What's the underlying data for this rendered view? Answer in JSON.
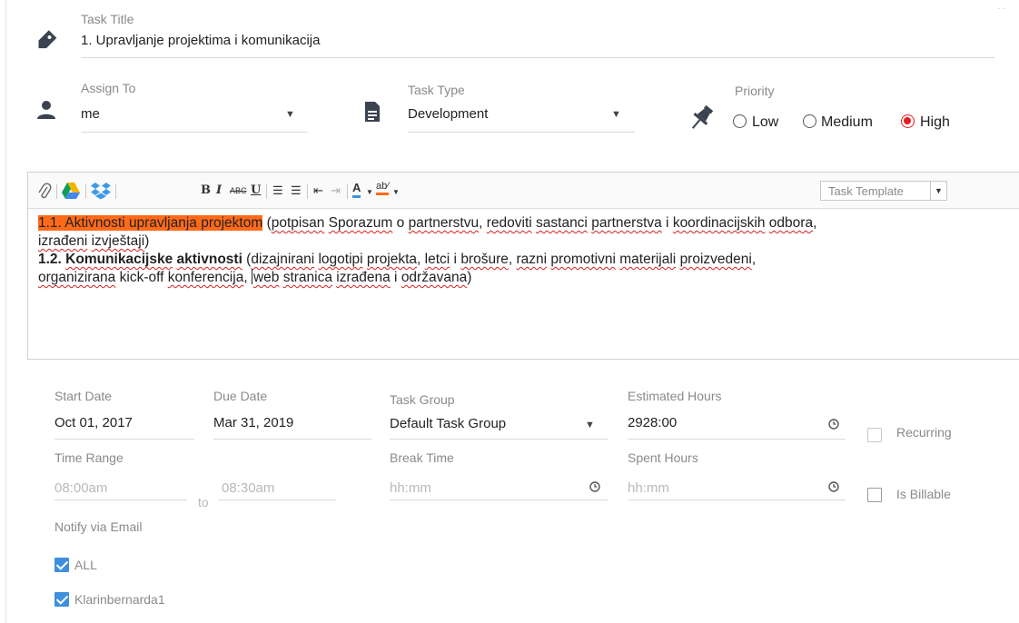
{
  "task_title": {
    "label": "Task Title",
    "value": "1. Upravljanje projektima i komunikacija"
  },
  "assign_to": {
    "label": "Assign To",
    "value": "me"
  },
  "task_type": {
    "label": "Task Type",
    "value": "Development"
  },
  "priority": {
    "label": "Priority",
    "options": [
      "Low",
      "Medium",
      "High"
    ],
    "selected": "High"
  },
  "editor": {
    "template_placeholder": "Task Template",
    "line1_highlight": "1.1. Aktivnosti upravljanja projektom",
    "line1_rest_parts": [
      " (",
      "potpisan",
      " ",
      "Sporazum",
      " o ",
      "partnerstvu",
      ", ",
      "redoviti",
      " ",
      "sastanci",
      " ",
      "partnerstva",
      " i ",
      "koordinacijskih",
      " ",
      "odbora",
      ","
    ],
    "line2_parts": [
      "izrađeni",
      " ",
      "izvještaji",
      ")"
    ],
    "line3_bold_num": "1.2. ",
    "line3_bold_title": "Komunikacijske",
    "line3_bold_word2": "aktivnosti",
    "line3_rest_parts": [
      " (",
      "dizajnirani",
      " ",
      "logotipi",
      " ",
      "projekta",
      ", ",
      "letci",
      " i ",
      "brošure",
      ", ",
      "razni",
      " ",
      "promotivni",
      " ",
      "materijali",
      " ",
      "proizvedeni",
      ","
    ],
    "line4_parts": [
      "organizirana",
      " kick-off ",
      "konferencija",
      ", ",
      "web",
      " ",
      "stranica",
      " ",
      "izrađena",
      " i ",
      "održavana",
      ")"
    ]
  },
  "start_date": {
    "label": "Start Date",
    "value": "Oct 01, 2017"
  },
  "due_date": {
    "label": "Due Date",
    "value": "Mar 31, 2019"
  },
  "task_group": {
    "label": "Task Group",
    "value": "Default Task Group"
  },
  "estimated_hours": {
    "label": "Estimated Hours",
    "value": "2928:00"
  },
  "recurring": {
    "label": "Recurring",
    "checked": false
  },
  "time_range": {
    "label": "Time Range",
    "from_placeholder": "08:00am",
    "to_text": "to",
    "to_placeholder": "08:30am"
  },
  "break_time": {
    "label": "Break Time",
    "placeholder": "hh:mm"
  },
  "spent_hours": {
    "label": "Spent Hours",
    "placeholder": "hh:mm"
  },
  "billable": {
    "label": "Is Billable",
    "checked": false
  },
  "notify": {
    "label": "Notify via Email",
    "items": [
      {
        "label": "ALL",
        "checked": true
      },
      {
        "label": "Klarinbernarda1",
        "checked": true
      }
    ]
  },
  "colors": {
    "accent": "#3f8fdf",
    "priority_high": "#e51c23",
    "highlight": "#ff6a1a",
    "icon": "#3b4250"
  },
  "icons": [
    "tag-icon",
    "person-icon",
    "document-icon",
    "pin-icon",
    "attach-icon",
    "google-drive-icon",
    "dropbox-icon",
    "clock-icon"
  ]
}
